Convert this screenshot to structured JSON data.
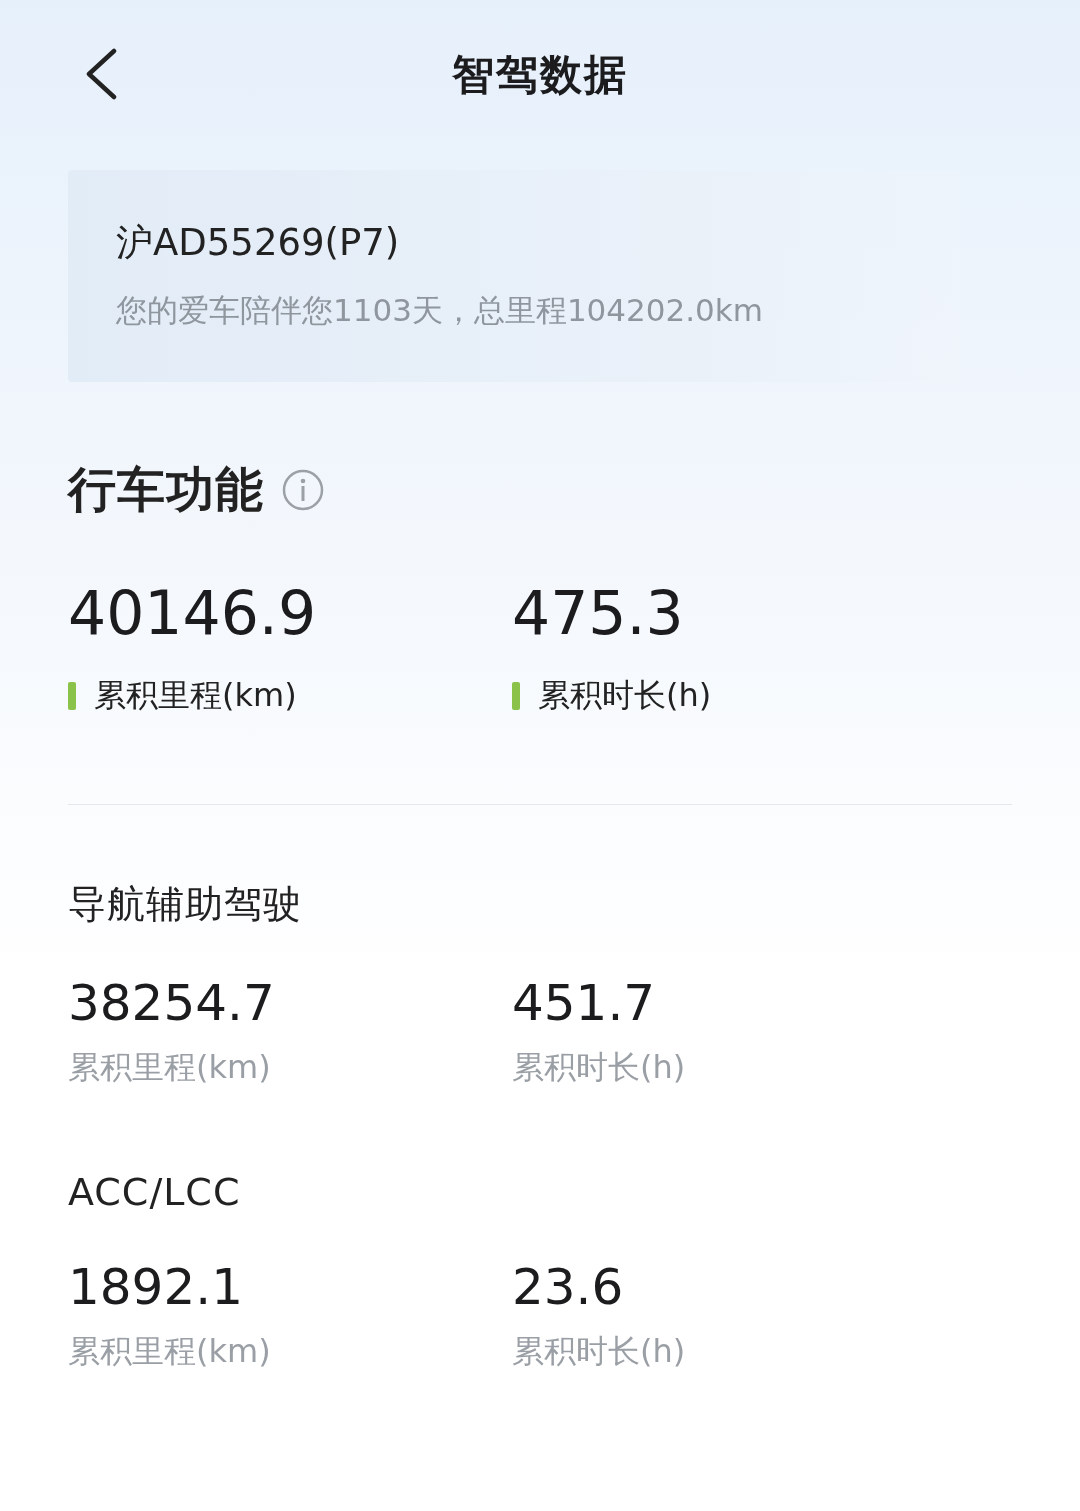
{
  "header": {
    "title": "智驾数据"
  },
  "vehicle_card": {
    "plate": "沪AD55269(P7)",
    "summary": "您的爱车陪伴您1103天，总里程104202.0km"
  },
  "sections": [
    {
      "kind": "primary",
      "title": "行车功能",
      "info": true,
      "stats": [
        {
          "value": "40146.9",
          "label": "累积里程(km)"
        },
        {
          "value": "475.3",
          "label": "累积时长(h)"
        }
      ]
    },
    {
      "kind": "secondary",
      "title": "导航辅助驾驶",
      "info": false,
      "stats": [
        {
          "value": "38254.7",
          "label": "累积里程(km)"
        },
        {
          "value": "451.7",
          "label": "累积时长(h)"
        }
      ]
    },
    {
      "kind": "secondary",
      "title": "ACC/LCC",
      "info": false,
      "stats": [
        {
          "value": "1892.1",
          "label": "累积里程(km)"
        },
        {
          "value": "23.6",
          "label": "累积时长(h)"
        }
      ]
    }
  ]
}
